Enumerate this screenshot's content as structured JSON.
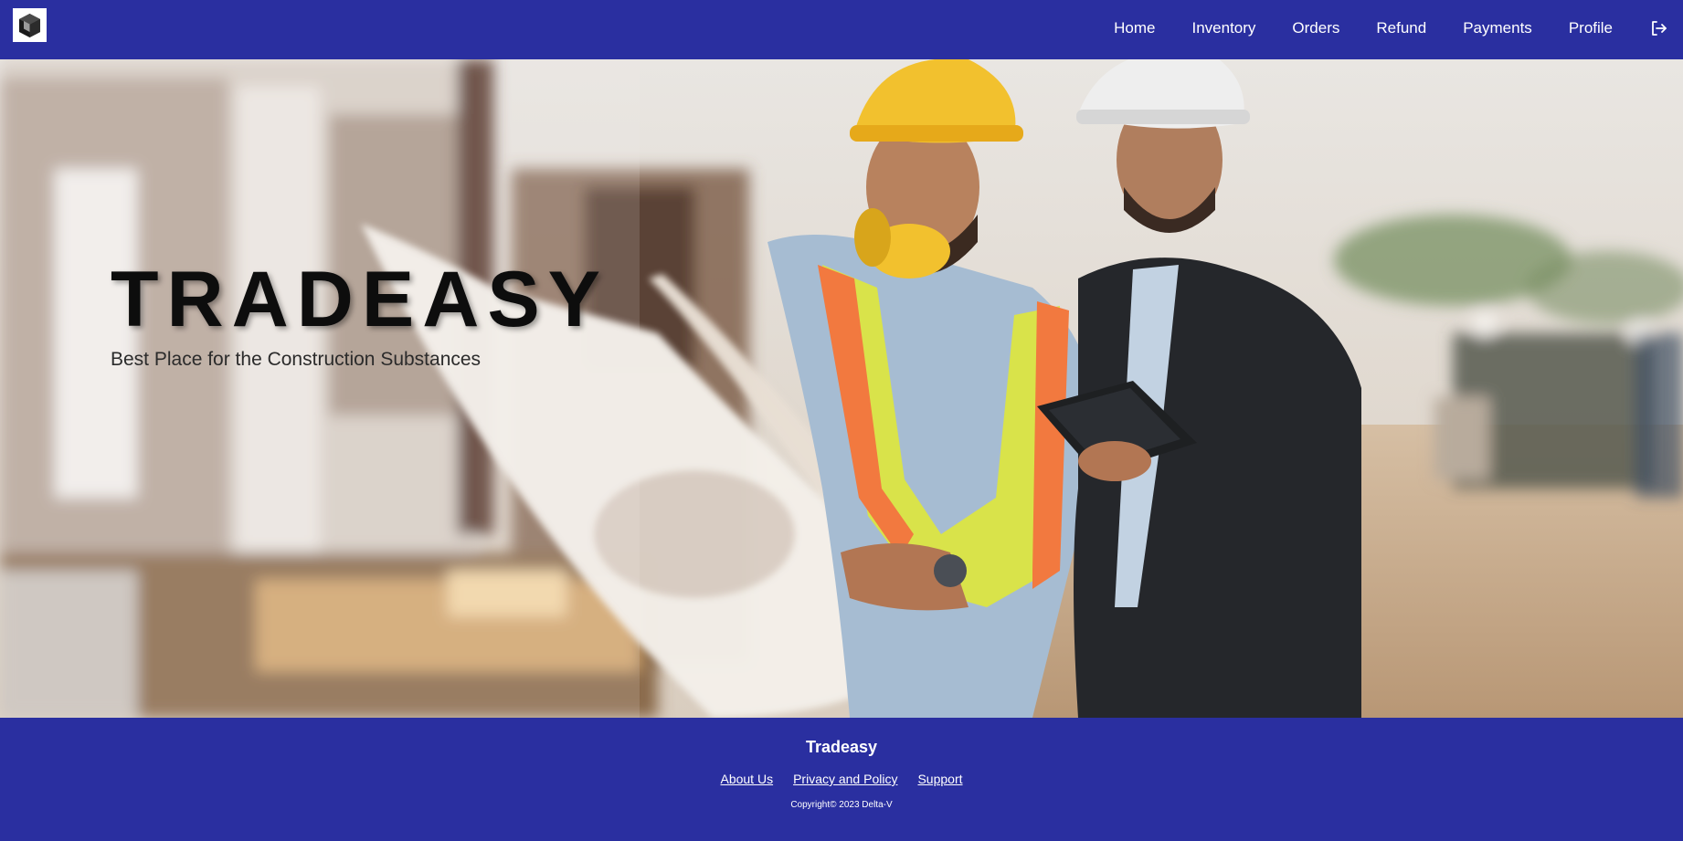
{
  "nav": {
    "logo_icon": "cube-logo-icon",
    "links": [
      "Home",
      "Inventory",
      "Orders",
      "Refund",
      "Payments",
      "Profile"
    ],
    "logout_icon": "logout-icon"
  },
  "hero": {
    "title": "TRADEASY",
    "subtitle": "Best Place for the Construction Substances",
    "image": "construction-workers-reviewing-blueprint-photo"
  },
  "footer": {
    "brand": "Tradeasy",
    "links": [
      "About Us",
      "Privacy and Policy",
      "Support"
    ],
    "copyright": "Copyright© 2023 Delta-V"
  },
  "colors": {
    "primary": "#2a2fa0",
    "text_light": "#ffffff",
    "title_dark": "#0d0d0d"
  }
}
